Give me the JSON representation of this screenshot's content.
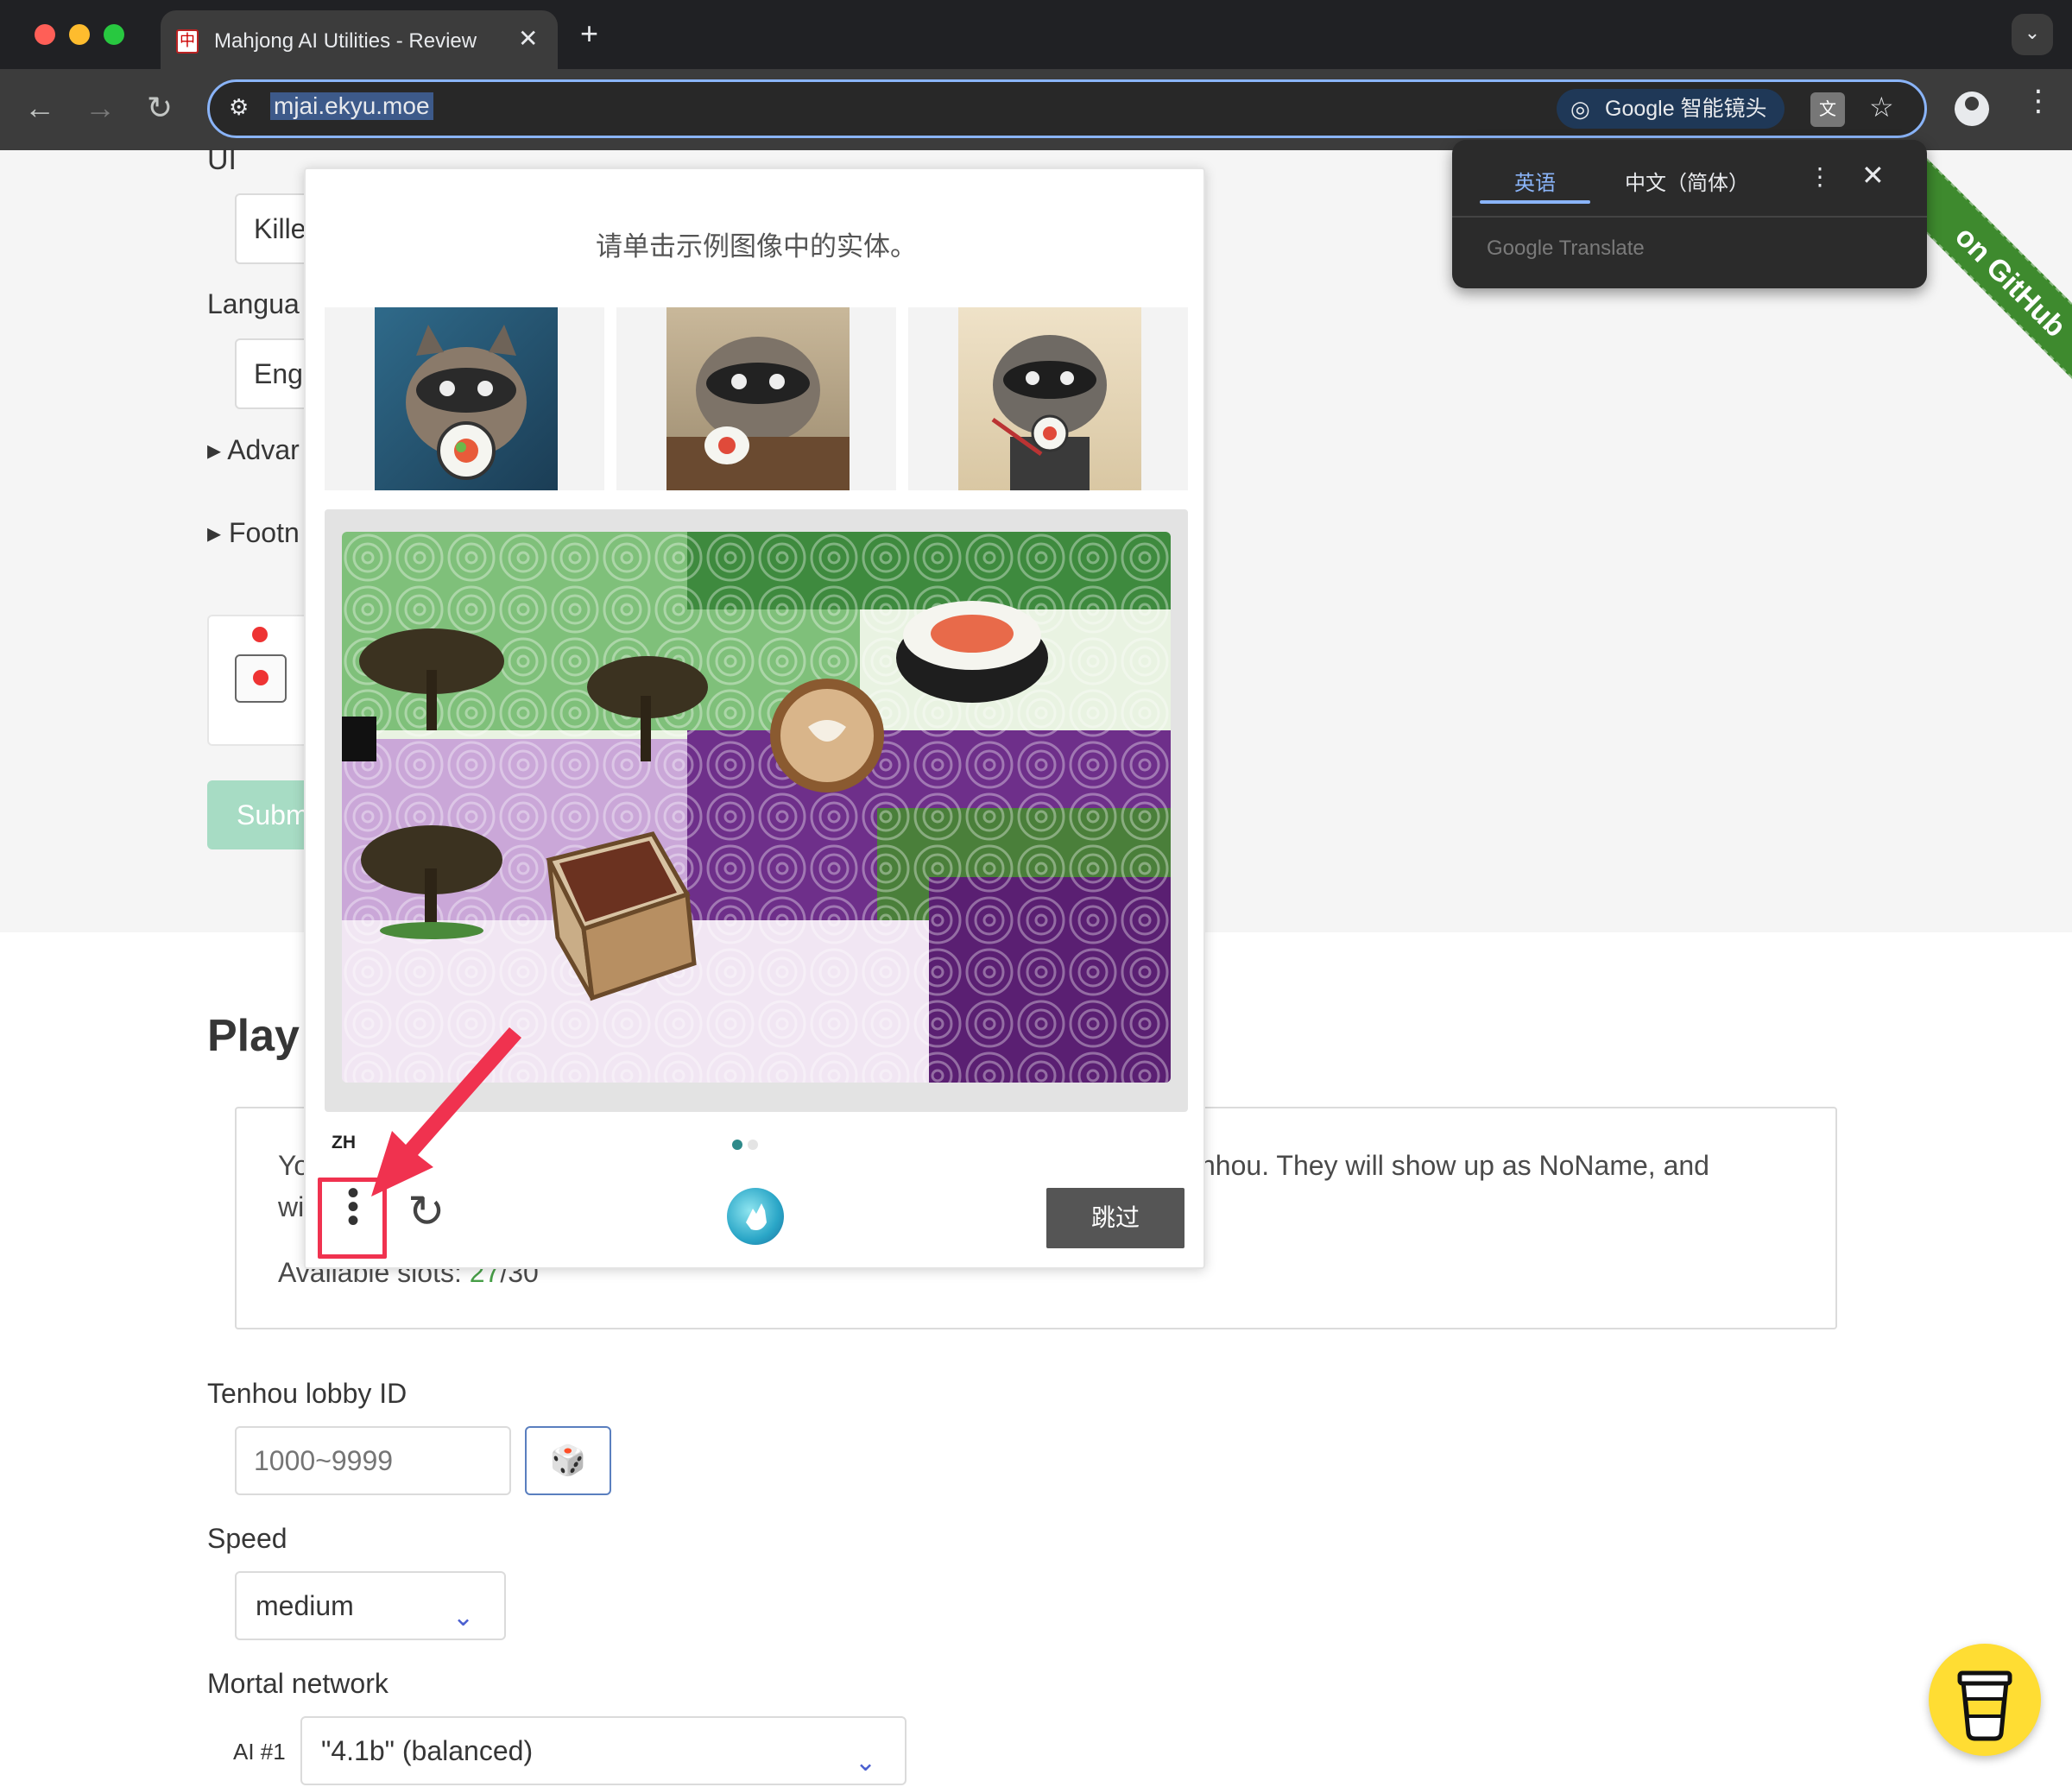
{
  "browser": {
    "tab_title": "Mahjong AI Utilities - Review",
    "tab_favicon_glyph": "中",
    "url": "mjai.ekyu.moe",
    "lens_label": "Google 智能镜头",
    "new_tab_glyph": "+",
    "close_glyph": "✕"
  },
  "translate_popup": {
    "tabs": [
      "英语",
      "中文（简体）"
    ],
    "active_tab": 0,
    "brand": "Google Translate"
  },
  "form": {
    "ui_label": "UI",
    "ui_value": "Kille",
    "language_label": "Langua",
    "language_value": "Eng",
    "advanced_label": "Advar",
    "footnotes_label": "Footn",
    "submit_label": "Subm"
  },
  "ribbon": {
    "text": "on GitHub"
  },
  "captcha": {
    "prompt": "请单击示例图像中的实体。",
    "lang_code": "ZH",
    "skip_label": "跳过",
    "pages": 2,
    "current_page": 1,
    "example_subject": "raccoon eating sushi",
    "main_objects": [
      "tree",
      "tree",
      "sushi roll",
      "latte",
      "tree",
      "treasure chest"
    ]
  },
  "play": {
    "title": "Play",
    "info_line1_start": "Yo",
    "info_line1_end": "nhou. They will show up as NoName, and",
    "info_line2_start": "wi",
    "slots_label": "Available slots: ",
    "slots_used": "27",
    "slots_total": "/30",
    "lobby_label": "Tenhou lobby ID",
    "lobby_placeholder": "1000~9999",
    "dice_icon": "🎲",
    "speed_label": "Speed",
    "speed_value": "medium",
    "network_label": "Mortal network",
    "ai_label": "AI #1",
    "ai_value": "\"4.1b\" (balanced)"
  },
  "colors": {
    "accent_blue": "#8ab4f8",
    "ribbon_green": "#3e8a2e",
    "highlight_red": "#f0324f",
    "submit_green": "#a7dcc4"
  }
}
